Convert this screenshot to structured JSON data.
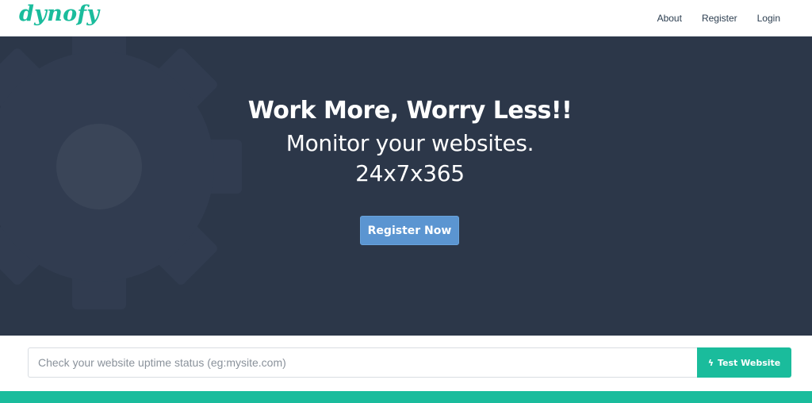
{
  "brand": {
    "logo": "dynofy",
    "accent": "#1abc9c"
  },
  "nav": {
    "links": [
      "About",
      "Register",
      "Login"
    ]
  },
  "hero": {
    "title": "Work More, Worry Less!!",
    "line1": "Monitor your websites.",
    "line2": "24x7x365",
    "cta": "Register Now",
    "background": "#2c3749",
    "decoration": "gear-icon"
  },
  "check": {
    "placeholder": "Check your website uptime status (eg:mysite.com)",
    "value": "",
    "button_label": "Test Website",
    "button_icon": "bolt-icon"
  }
}
